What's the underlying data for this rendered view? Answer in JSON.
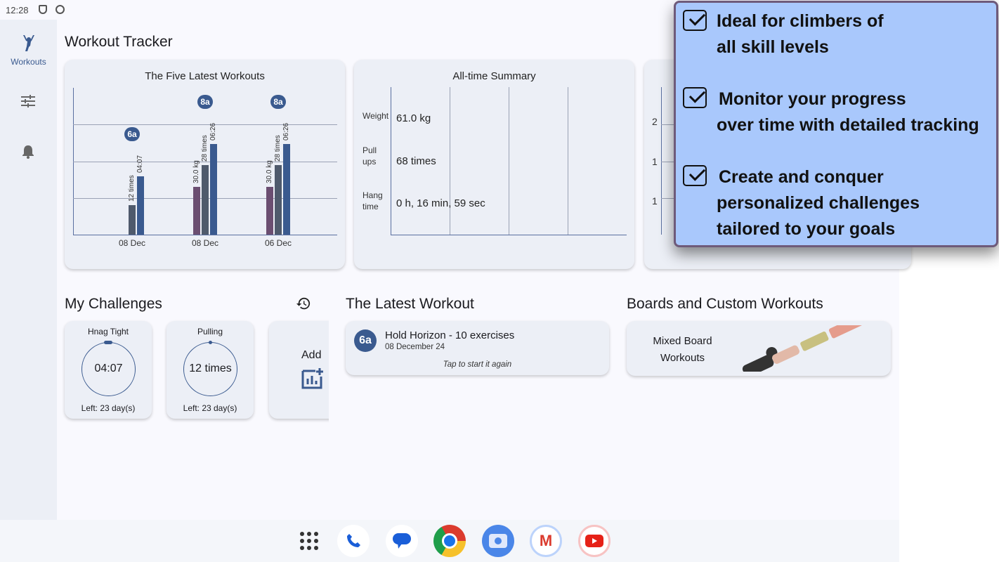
{
  "status": {
    "time": "12:28"
  },
  "sidebar": {
    "items": [
      {
        "label": "Workouts",
        "icon": "climber-icon"
      },
      {
        "icon": "sliders-icon"
      },
      {
        "icon": "bell-icon"
      }
    ]
  },
  "header": {
    "title": "Workout Tracker"
  },
  "latest_chart": {
    "title": "The Five Latest Workouts"
  },
  "summary": {
    "title": "All-time Summary",
    "rows": [
      {
        "label": "Weight",
        "value": "61.0 kg"
      },
      {
        "label": "Pull ups",
        "value": "68 times"
      },
      {
        "label": "Hang time",
        "value": "0 h, 16 min, 59 sec"
      }
    ]
  },
  "third_chart": {
    "ticks": [
      "2",
      "1",
      "1"
    ]
  },
  "chart_data": {
    "type": "bar",
    "title": "The Five Latest Workouts",
    "categories": [
      "08 Dec",
      "08 Dec",
      "06 Dec"
    ],
    "grades": [
      "6a",
      "8a",
      "8a"
    ],
    "ylim": [
      0,
      4
    ],
    "series": [
      {
        "name": "weight",
        "color": "#6b4e71",
        "values": [
          null,
          1.31,
          1.31
        ],
        "labels": [
          "",
          "30.0 kg",
          "30.0 kg"
        ]
      },
      {
        "name": "pull ups",
        "color": "#4f5a6c",
        "values": [
          0.8,
          1.89,
          1.89
        ],
        "labels": [
          "12 times",
          "28 times",
          "28 times"
        ]
      },
      {
        "name": "hang time",
        "color": "#3a5a8f",
        "values": [
          1.58,
          2.46,
          2.46
        ],
        "labels": [
          "04:07",
          "06:26",
          "06:26"
        ]
      }
    ]
  },
  "challenges": {
    "title": "My Challenges",
    "items": [
      {
        "name": "Hnag Tight",
        "value": "04:07",
        "left": "Left: 23 day(s)",
        "progress": 0.02
      },
      {
        "name": "Pulling",
        "value": "12 times",
        "left": "Left: 23 day(s)",
        "progress": 0
      }
    ],
    "add_label": "Add"
  },
  "latest_workout": {
    "title": "The Latest Workout",
    "grade": "6a",
    "name": "Hold Horizon - 10 exercises",
    "date": "08 December 24",
    "hint": "Tap to start it again"
  },
  "boards": {
    "title": "Boards and Custom Workouts",
    "card_label": "Mixed Board Workouts"
  },
  "overlay": {
    "features": [
      {
        "line1": "Ideal for climbers of",
        "line2": "all skill  levels"
      },
      {
        "line1": "Monitor your progress",
        "line2": "over time with detailed tracking"
      },
      {
        "line1": "Create and conquer",
        "line2": "personalized challenges",
        "line3": "tailored to your goals"
      }
    ]
  },
  "dock": [
    "apps-grid-icon",
    "phone-icon",
    "messages-icon",
    "chrome-icon",
    "camera-icon",
    "gmail-icon",
    "youtube-icon"
  ],
  "colors": {
    "accent": "#3a5a8f",
    "overlay": "#a9c8fc"
  }
}
